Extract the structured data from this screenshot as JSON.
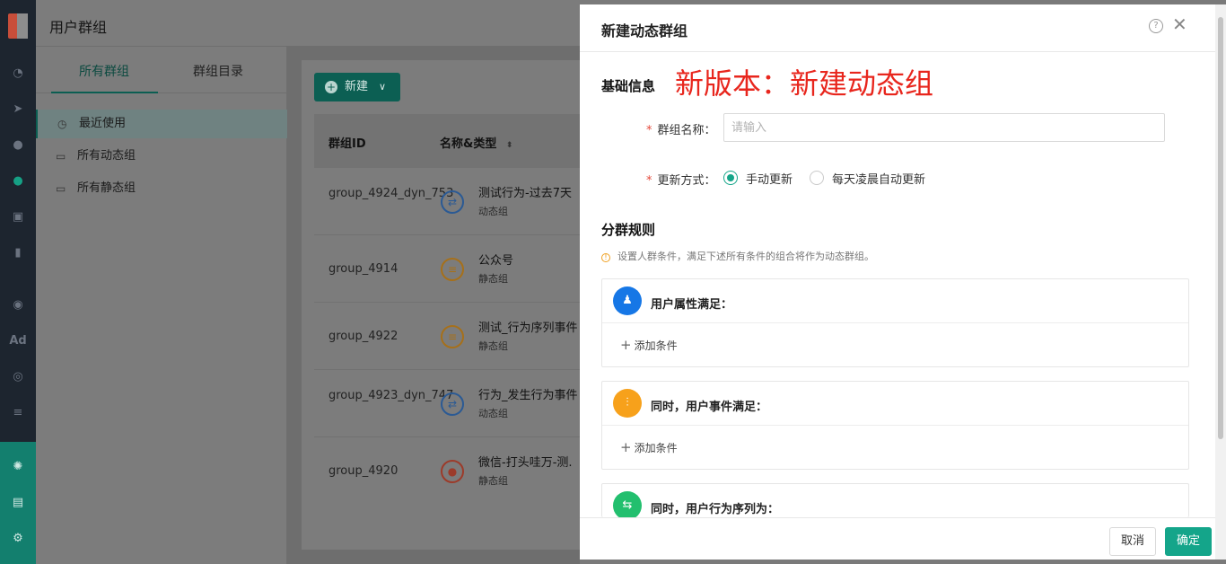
{
  "sidebar": {
    "icons": [
      "dashboard-icon",
      "send-icon",
      "user-icon",
      "users-icon",
      "contact-card-icon",
      "bar-chart-icon",
      "wechat-icon",
      "ad-icon",
      "target-icon",
      "list-icon",
      "team-hub-icon",
      "server-icon",
      "gear-icon"
    ],
    "ad_label": "Ad"
  },
  "header": {
    "title": "用户群组"
  },
  "subnav": {
    "tabs": [
      "所有群组",
      "群组目录"
    ],
    "items": [
      "最近使用",
      "所有动态组",
      "所有静态组"
    ]
  },
  "main": {
    "new_button": "新建",
    "columns": [
      "群组ID",
      "名称&类型"
    ],
    "rows": [
      {
        "id": "group_4924_dyn_753",
        "name": "测试行为-过去7天",
        "type": "动态组",
        "icon": "sync-icon"
      },
      {
        "id": "group_4914",
        "name": "公众号",
        "type": "静态组",
        "icon": "list-icon"
      },
      {
        "id": "group_4922",
        "name": "测试_行为序列事件",
        "type": "静态组",
        "icon": "list-icon"
      },
      {
        "id": "group_4923_dyn_747",
        "name": "行为_发生行为事件",
        "type": "动态组",
        "icon": "sync-icon"
      },
      {
        "id": "group_4920",
        "name": "微信-打头哇万-测.",
        "type": "静态组",
        "icon": "person-icon"
      }
    ]
  },
  "drawer": {
    "title": "新建动态群组",
    "basic_info": "基础信息",
    "stamp": "新版本：新建动态组",
    "name_label": "群组名称：",
    "name_placeholder": "请输入",
    "name_value": "",
    "update_label": "更新方式：",
    "update_options": [
      "手动更新",
      "每天凌晨自动更新"
    ],
    "update_selected": "手动更新",
    "rules_title": "分群规则",
    "rules_hint": "设置人群条件，满足下述所有条件的组合将作为动态群组。",
    "rules": [
      {
        "title": "用户属性满足：",
        "add": "添加条件",
        "color": "#1677e6",
        "icon": "user-attr-icon"
      },
      {
        "title": "同时，用户事件满足：",
        "add": "添加条件",
        "color": "#f7a11b",
        "icon": "event-icon"
      },
      {
        "title": "同时，用户行为序列为：",
        "color": "#22bf6e",
        "icon": "sequence-icon"
      }
    ],
    "cancel": "取消",
    "confirm": "确定"
  }
}
